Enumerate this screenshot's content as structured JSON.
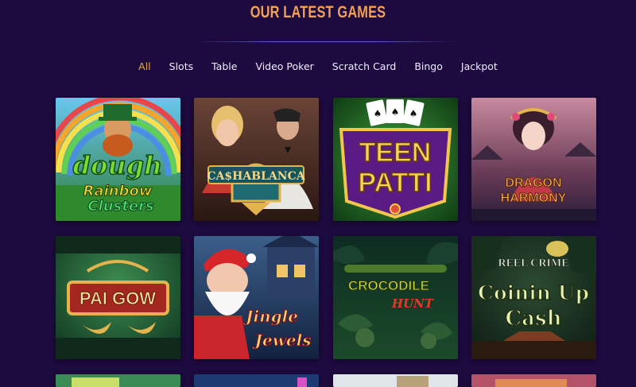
{
  "section": {
    "title": "OUR LATEST GAMES"
  },
  "tabs": [
    {
      "label": "All",
      "active": true
    },
    {
      "label": "Slots",
      "active": false
    },
    {
      "label": "Table",
      "active": false
    },
    {
      "label": "Video Poker",
      "active": false
    },
    {
      "label": "Scratch Card",
      "active": false
    },
    {
      "label": "Bingo",
      "active": false
    },
    {
      "label": "Jackpot",
      "active": false
    }
  ],
  "games": [
    {
      "name": "Bubba Dough Rainbow Clusters",
      "logo_line1": "dough",
      "logo_line2": "Rainbow",
      "logo_line3": "Clusters"
    },
    {
      "name": "Cashablanca",
      "logo_line1": "CA$HABLANCA"
    },
    {
      "name": "Teen Patti",
      "logo_line1": "TEEN",
      "logo_line2": "PATTI"
    },
    {
      "name": "Dragon Harmony",
      "logo_line1": "DRAGON",
      "logo_line2": "HARMONY"
    },
    {
      "name": "Pai Gow",
      "logo_line1": "PAI GOW"
    },
    {
      "name": "Jingle Jewels",
      "logo_line1": "Jingle",
      "logo_line2": "Jewels"
    },
    {
      "name": "Crocodile Hunt",
      "logo_line1": "CROCODILE",
      "logo_line2": "HUNT"
    },
    {
      "name": "Reel Crime Coinin Up Cash",
      "logo_line1": "REEL CRIME",
      "logo_line2": "Coinin Up",
      "logo_line3": "Cash"
    }
  ],
  "colors": {
    "background": "#1d0a3e",
    "title": "#f0a05a",
    "active_tab": "#e9a93f",
    "tab": "#f1ecff"
  }
}
